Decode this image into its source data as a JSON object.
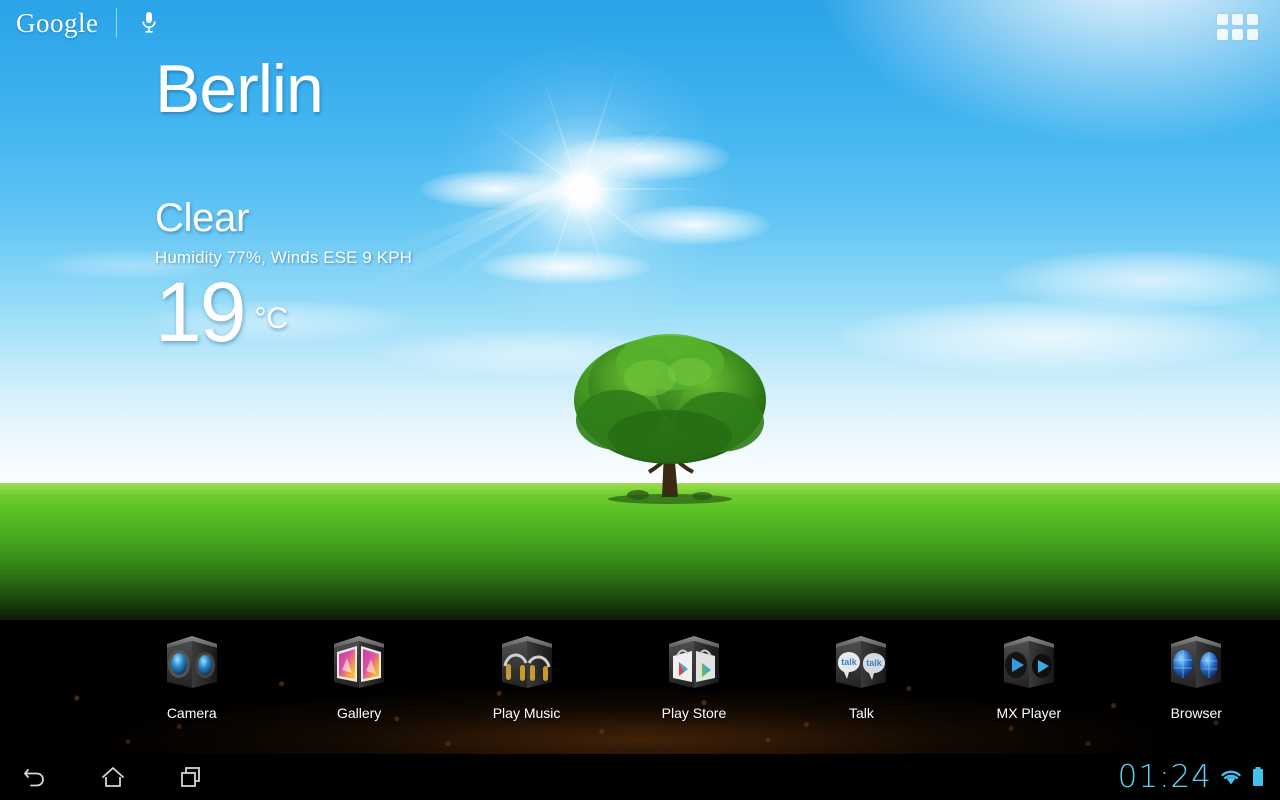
{
  "search_bar": {
    "brand_label": "Google",
    "mic_icon": "microphone-icon"
  },
  "apps_button": {
    "icon": "apps-grid-icon",
    "label": "Apps"
  },
  "weather_widget": {
    "city": "Berlin",
    "condition": "Clear",
    "details": "Humidity 77%, Winds ESE 9 KPH",
    "temperature": "19",
    "unit": "°C"
  },
  "dock": {
    "apps": [
      {
        "label": "Camera",
        "icon": "camera-icon"
      },
      {
        "label": "Gallery",
        "icon": "gallery-icon"
      },
      {
        "label": "Play Music",
        "icon": "play-music-icon"
      },
      {
        "label": "Play Store",
        "icon": "play-store-icon"
      },
      {
        "label": "Talk",
        "icon": "talk-icon"
      },
      {
        "label": "MX Player",
        "icon": "mx-player-icon"
      },
      {
        "label": "Browser",
        "icon": "browser-icon"
      }
    ]
  },
  "system_bar": {
    "back_icon": "back-arrow-icon",
    "home_icon": "home-icon",
    "recents_icon": "recent-apps-icon",
    "clock": "01:24",
    "wifi_icon": "wifi-icon",
    "battery_icon": "battery-full-icon"
  },
  "colors": {
    "sky_top": "#2aa3e8",
    "sky_horizon": "#ffffff",
    "grass": "#57c024",
    "status_accent": "#5fd0f5",
    "dock_background": "#000000"
  }
}
